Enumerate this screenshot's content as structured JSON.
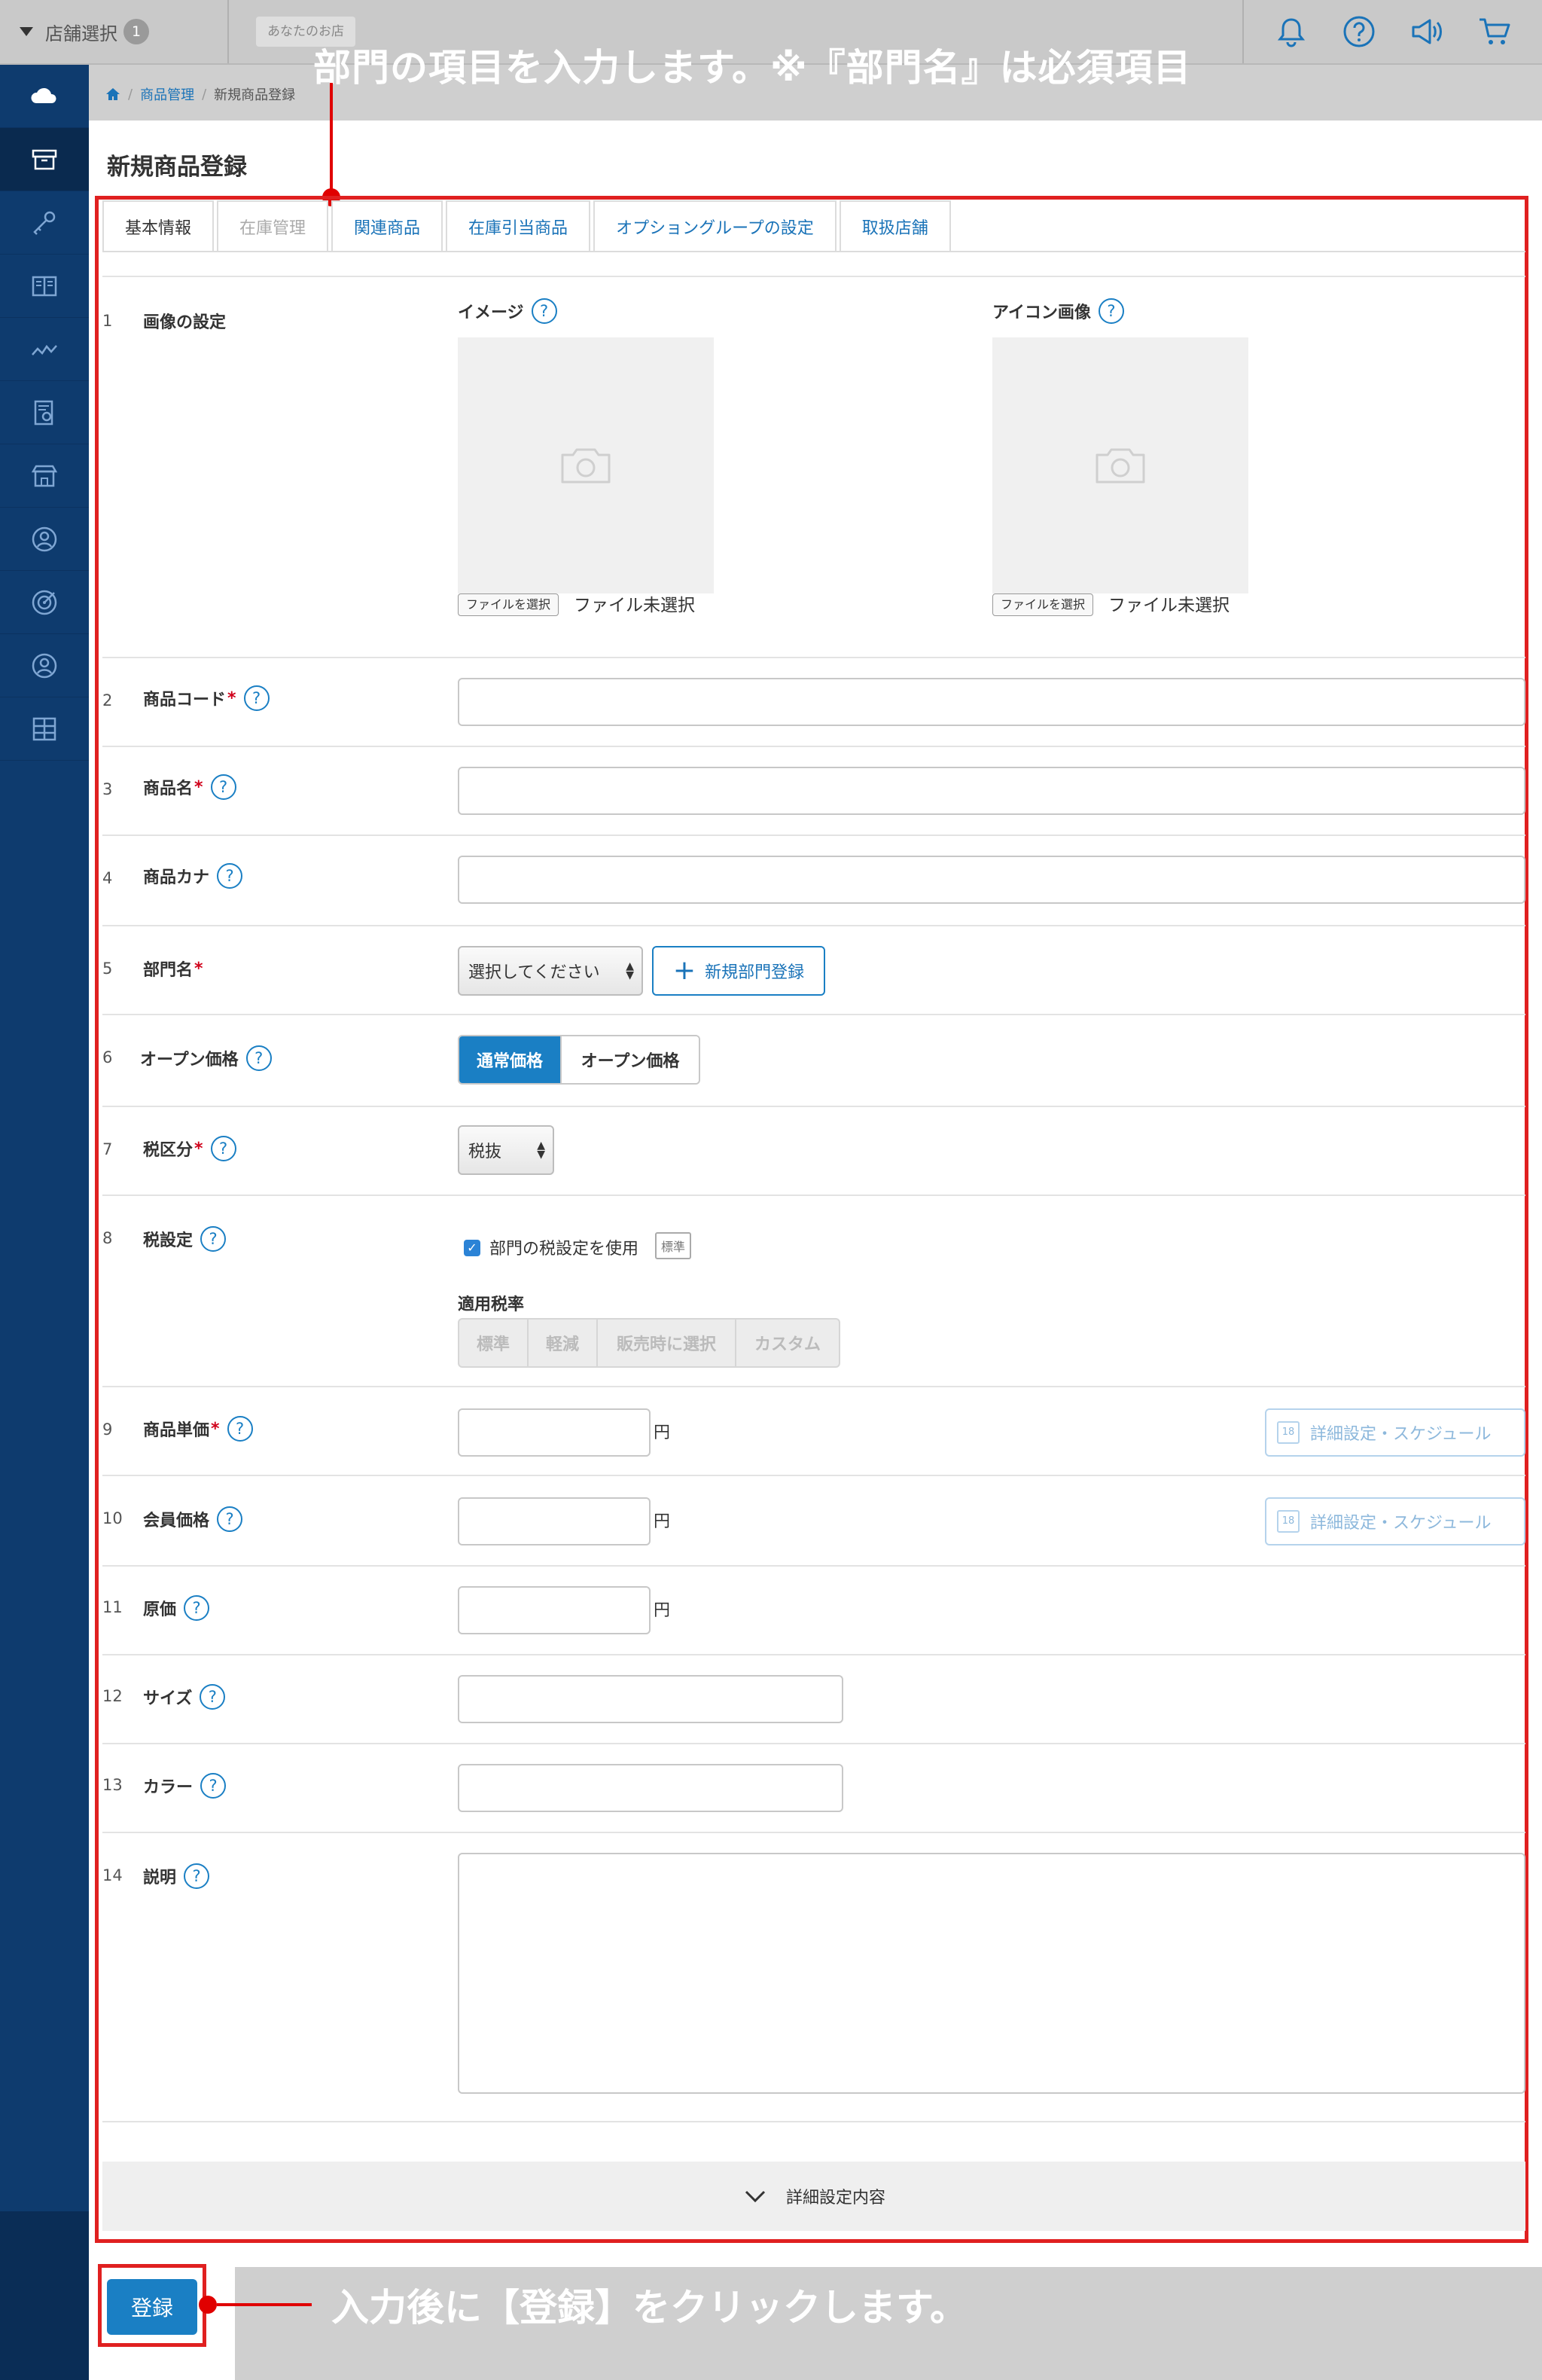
{
  "topbar": {
    "store_select_label": "店舗選択",
    "store_count": "1",
    "store_name": "あなたのお店",
    "icons": [
      "bell-icon",
      "help-icon",
      "megaphone-icon",
      "cart-icon"
    ]
  },
  "sidebar": {
    "items": [
      "cloud-icon",
      "box-icon",
      "key-icon",
      "book-icon",
      "chart-icon",
      "report-icon",
      "store-icon",
      "user-icon",
      "target-icon",
      "customer-icon",
      "grid-icon"
    ]
  },
  "breadcrumb": {
    "items": [
      "商品管理",
      "新規商品登録"
    ]
  },
  "page": {
    "title": "新規商品登録"
  },
  "annotations": {
    "top": "部門の項目を入力します。※『部門名』は必須項目",
    "bottom": "入力後に【登録】をクリックします。"
  },
  "tabs": [
    {
      "label": "基本情報",
      "state": "active"
    },
    {
      "label": "在庫管理",
      "state": "disabled"
    },
    {
      "label": "関連商品",
      "state": "link"
    },
    {
      "label": "在庫引当商品",
      "state": "link"
    },
    {
      "label": "オプショングループの設定",
      "state": "link"
    },
    {
      "label": "取扱店舗",
      "state": "link"
    }
  ],
  "form": {
    "rows": [
      {
        "num": "1",
        "label": "画像の設定",
        "required": false
      },
      {
        "num": "2",
        "label": "商品コード",
        "required": true
      },
      {
        "num": "3",
        "label": "商品名",
        "required": true
      },
      {
        "num": "4",
        "label": "商品カナ",
        "required": false
      },
      {
        "num": "5",
        "label": "部門名",
        "required": true
      },
      {
        "num": "6",
        "label": "オープン価格",
        "required": false
      },
      {
        "num": "7",
        "label": "税区分",
        "required": true
      },
      {
        "num": "8",
        "label": "税設定",
        "required": false
      },
      {
        "num": "9",
        "label": "商品単価",
        "required": true
      },
      {
        "num": "10",
        "label": "会員価格",
        "required": false
      },
      {
        "num": "11",
        "label": "原価",
        "required": false
      },
      {
        "num": "12",
        "label": "サイズ",
        "required": false
      },
      {
        "num": "13",
        "label": "カラー",
        "required": false
      },
      {
        "num": "14",
        "label": "説明",
        "required": false
      }
    ],
    "required_mark": "*",
    "help_mark": "?",
    "image": {
      "image_label": "イメージ",
      "icon_label": "アイコン画像",
      "file_button": "ファイルを選択",
      "file_status": "ファイル未選択"
    },
    "department": {
      "select_value": "選択してください",
      "new_button": "新規部門登録"
    },
    "open_price": {
      "options": [
        "通常価格",
        "オープン価格"
      ],
      "selected": "通常価格"
    },
    "tax_class": {
      "select_value": "税抜"
    },
    "tax_setting": {
      "checkbox_label": "部門の税設定を使用",
      "checked": true,
      "badge": "標準",
      "rate_label": "適用税率",
      "rate_options": [
        "標準",
        "軽減",
        "販売時に選択",
        "カスタム"
      ]
    },
    "unit_yen": "円",
    "schedule_button": "詳細設定・スケジュール"
  },
  "detail_toggle": "詳細設定内容",
  "submit_button": "登録"
}
